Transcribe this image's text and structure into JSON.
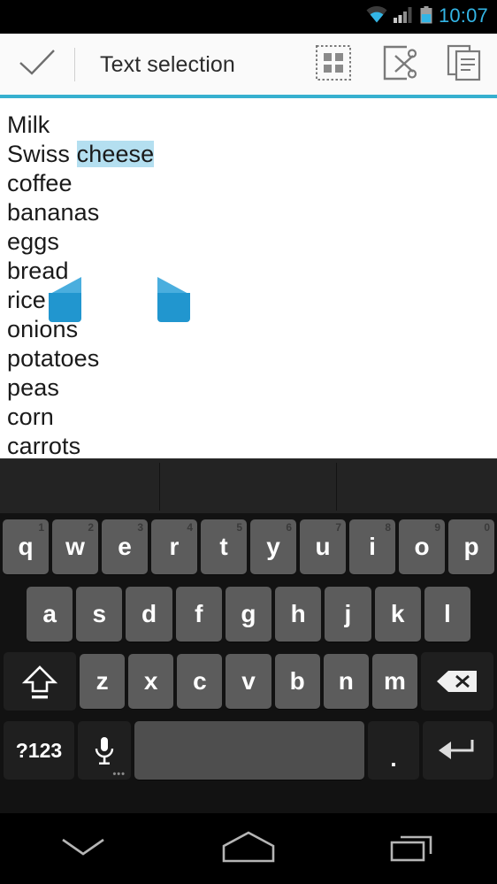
{
  "status_bar": {
    "time": "10:07",
    "icons": [
      "wifi-icon",
      "signal-icon",
      "battery-icon"
    ],
    "accent_color": "#33b5e5"
  },
  "action_bar": {
    "done_icon": "check-icon",
    "title": "Text selection",
    "buttons": [
      {
        "name": "select-all-button",
        "icon": "select-all-icon"
      },
      {
        "name": "cut-button",
        "icon": "scissors-icon"
      },
      {
        "name": "copy-button",
        "icon": "copy-icon"
      }
    ],
    "accent_line_color": "#36b0cf"
  },
  "editor": {
    "lines": [
      {
        "text": "Milk",
        "selected": ""
      },
      {
        "pre": "Swiss ",
        "selected": "cheese",
        "post": ""
      },
      {
        "text": "coffee",
        "selected": ""
      },
      {
        "text": "bananas",
        "selected": ""
      },
      {
        "text": "eggs",
        "selected": ""
      },
      {
        "text": "bread",
        "selected": ""
      },
      {
        "text": "rice",
        "selected": ""
      },
      {
        "text": "onions",
        "selected": ""
      },
      {
        "text": "potatoes",
        "selected": ""
      },
      {
        "text": "peas",
        "selected": ""
      },
      {
        "text": "corn",
        "selected": ""
      },
      {
        "text": "carrots",
        "selected": ""
      }
    ],
    "selected_text": "cheese",
    "selection_highlight_color": "#b4dff0",
    "handle_color": "#2196cf"
  },
  "keyboard": {
    "suggestions": [
      "",
      "",
      ""
    ],
    "row1": [
      {
        "key": "q",
        "hint": "1"
      },
      {
        "key": "w",
        "hint": "2"
      },
      {
        "key": "e",
        "hint": "3"
      },
      {
        "key": "r",
        "hint": "4"
      },
      {
        "key": "t",
        "hint": "5"
      },
      {
        "key": "y",
        "hint": "6"
      },
      {
        "key": "u",
        "hint": "7"
      },
      {
        "key": "i",
        "hint": "8"
      },
      {
        "key": "o",
        "hint": "9"
      },
      {
        "key": "p",
        "hint": "0"
      }
    ],
    "row2": [
      {
        "key": "a"
      },
      {
        "key": "s"
      },
      {
        "key": "d"
      },
      {
        "key": "f"
      },
      {
        "key": "g"
      },
      {
        "key": "h"
      },
      {
        "key": "j"
      },
      {
        "key": "k"
      },
      {
        "key": "l"
      }
    ],
    "row3": [
      {
        "key": "z"
      },
      {
        "key": "x"
      },
      {
        "key": "c"
      },
      {
        "key": "v"
      },
      {
        "key": "b"
      },
      {
        "key": "n"
      },
      {
        "key": "m"
      }
    ],
    "shift_label": "shift-key",
    "delete_label": "delete-key",
    "symbols_label": "?123",
    "mic_label": "mic-key",
    "space_label": "",
    "period_label": ".",
    "enter_label": "enter-key"
  },
  "nav_bar": {
    "buttons": [
      {
        "name": "hide-keyboard-button",
        "icon": "chevron-down-icon"
      },
      {
        "name": "home-button",
        "icon": "home-icon"
      },
      {
        "name": "recents-button",
        "icon": "recents-icon"
      }
    ]
  }
}
